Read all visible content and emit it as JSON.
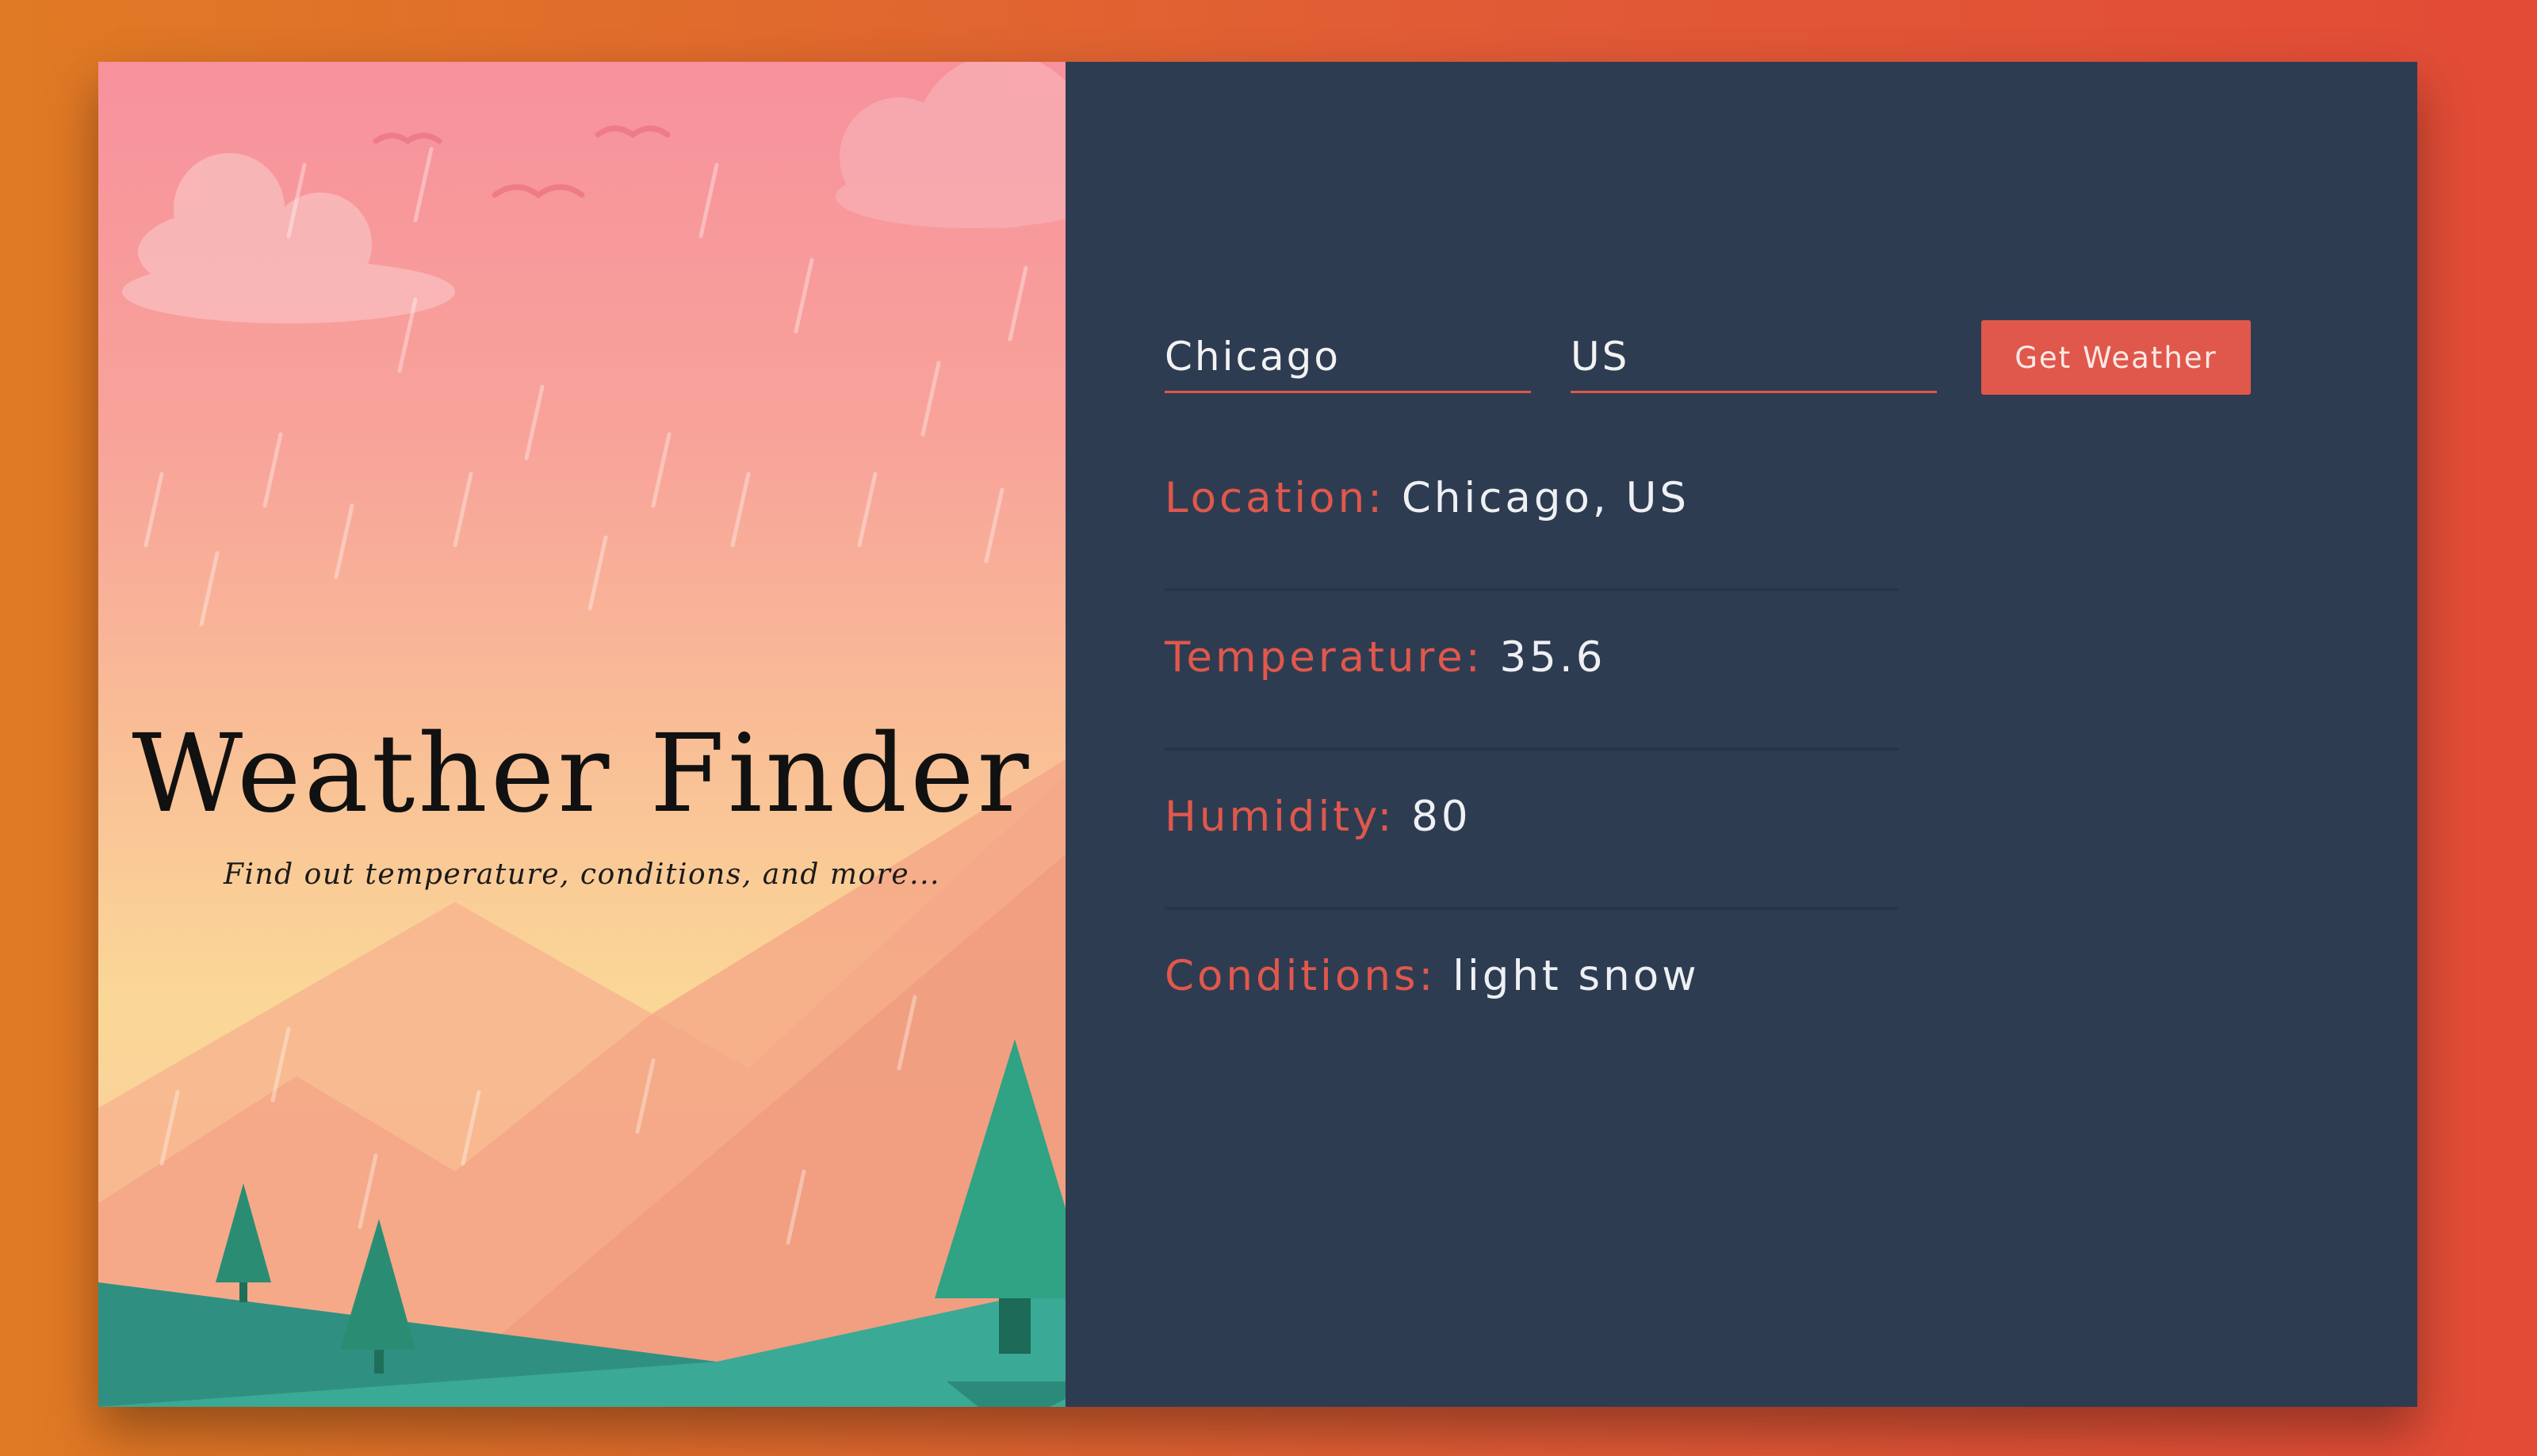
{
  "hero": {
    "title": "Weather Finder",
    "subtitle": "Find out temperature, conditions, and more..."
  },
  "form": {
    "city_value": "Chicago",
    "country_value": "US",
    "button_label": "Get Weather"
  },
  "results": [
    {
      "label": "Location:",
      "value": "Chicago, US"
    },
    {
      "label": "Temperature:",
      "value": "35.6"
    },
    {
      "label": "Humidity:",
      "value": "80"
    },
    {
      "label": "Conditions:",
      "value": "light snow"
    }
  ],
  "colors": {
    "background_gradient_start": "#e07a24",
    "background_gradient_end": "#e24b36",
    "panel": "#2e3c52",
    "accent": "#e0584b",
    "text_light": "#eef0f3"
  }
}
